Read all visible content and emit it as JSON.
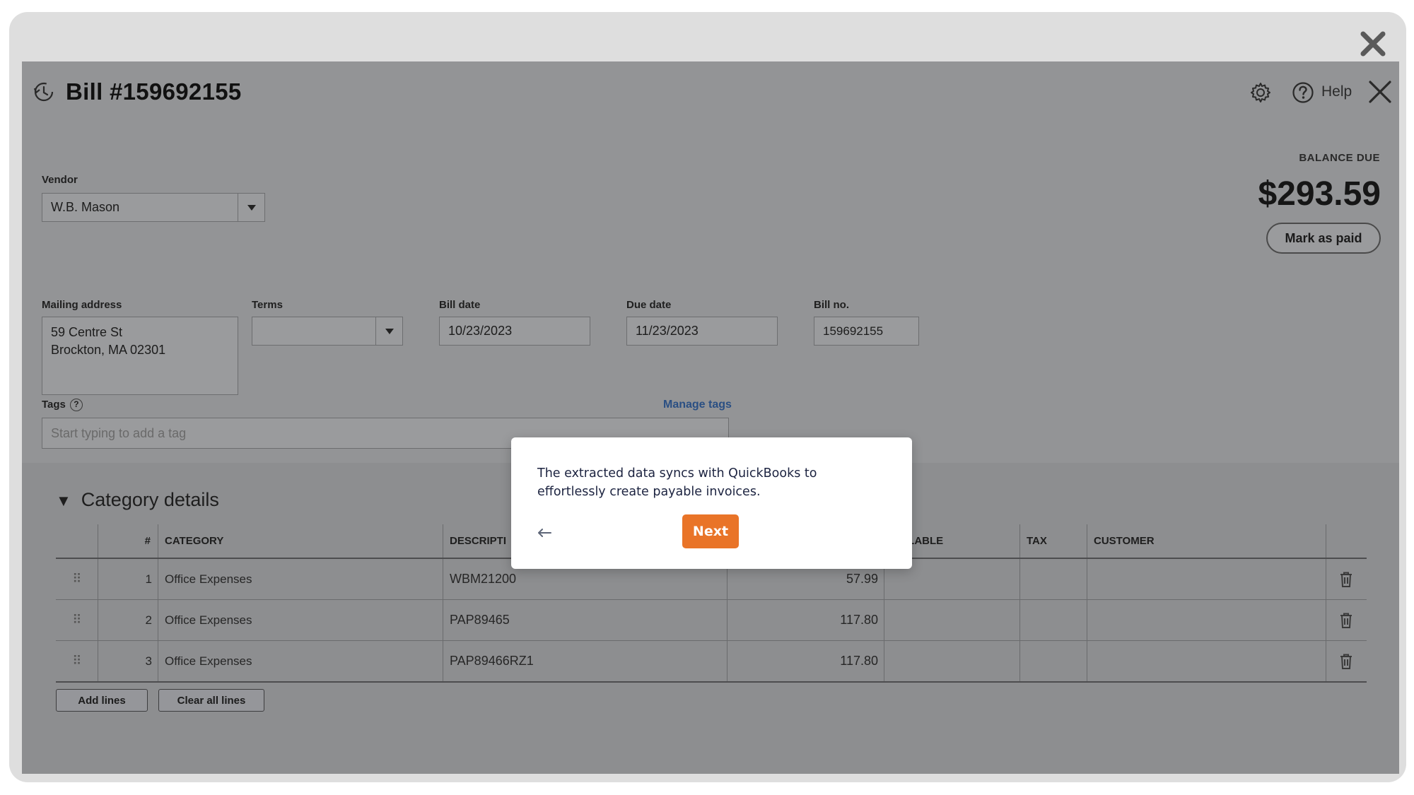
{
  "bill": {
    "title": "Bill #159692155",
    "help_label": "Help"
  },
  "balance": {
    "label": "BALANCE DUE",
    "amount": "$293.59",
    "mark_paid_label": "Mark as paid"
  },
  "vendor": {
    "label": "Vendor",
    "value": "W.B. Mason"
  },
  "mailing": {
    "label": "Mailing address",
    "line1": "59 Centre St",
    "line2": "Brockton, MA 02301"
  },
  "terms": {
    "label": "Terms",
    "value": ""
  },
  "bill_date": {
    "label": "Bill date",
    "value": "10/23/2023"
  },
  "due_date": {
    "label": "Due date",
    "value": "11/23/2023"
  },
  "bill_no": {
    "label": "Bill no.",
    "value": "159692155"
  },
  "tags": {
    "label": "Tags",
    "help_glyph": "?",
    "manage_label": "Manage tags",
    "placeholder": "Start typing to add a tag"
  },
  "category": {
    "section_title": "Category details",
    "headers": {
      "num": "#",
      "category": "CATEGORY",
      "description": "DESCRIPTI",
      "amount": "",
      "billable": "BILLABLE",
      "tax": "TAX",
      "customer": "CUSTOMER"
    },
    "rows": [
      {
        "num": "1",
        "category": "Office Expenses",
        "description": "WBM21200",
        "amount": "57.99"
      },
      {
        "num": "2",
        "category": "Office Expenses",
        "description": "PAP89465",
        "amount": "117.80"
      },
      {
        "num": "3",
        "category": "Office Expenses",
        "description": "PAP89466RZ1",
        "amount": "117.80"
      }
    ],
    "add_lines_label": "Add lines",
    "clear_lines_label": "Clear all lines"
  },
  "popover": {
    "text": "The extracted data syncs with QuickBooks to effortlessly create payable invoices.",
    "next_label": "Next"
  },
  "colors": {
    "accent": "#e97428",
    "overlay": "#939496",
    "link": "#2a4f83"
  },
  "icons": [
    "close-icon",
    "bill-history-icon",
    "gear-icon",
    "help-circle-icon",
    "chevron-down-icon",
    "drag-handle-icon",
    "trash-icon",
    "arrow-left-icon"
  ]
}
